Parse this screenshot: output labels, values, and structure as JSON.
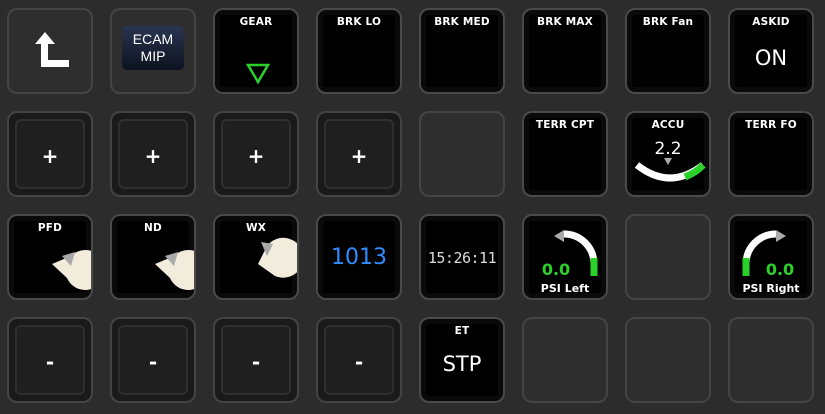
{
  "row1": {
    "ecam_line1": "ECAM",
    "ecam_line2": "MIP",
    "gear": "GEAR",
    "brk_lo": "BRK LO",
    "brk_med": "BRK MED",
    "brk_max": "BRK MAX",
    "brk_fan": "BRK Fan",
    "askid": "ASKID",
    "askid_state": "ON"
  },
  "row2": {
    "plus": "+",
    "terr_cpt": "TERR CPT",
    "accu": "ACCU",
    "accu_value": "2.2",
    "terr_fo": "TERR FO"
  },
  "row3": {
    "pfd": "PFD",
    "nd": "ND",
    "wx": "WX",
    "baro": "1013",
    "clock": "15:26:11",
    "psi_left_value": "0.0",
    "psi_left": "PSI Left",
    "psi_right_value": "0.0",
    "psi_right": "PSI Right"
  },
  "row4": {
    "minus": "-",
    "et": "ET",
    "et_state": "STP"
  },
  "icons": [
    "up-left-arrow-icon",
    "gear-down-triangle-icon",
    "pie-dial-icon",
    "gauge-arc-icon"
  ],
  "colors": {
    "green": "#2bd12b",
    "baro_blue": "#2f8dff",
    "white": "#ffffff"
  }
}
